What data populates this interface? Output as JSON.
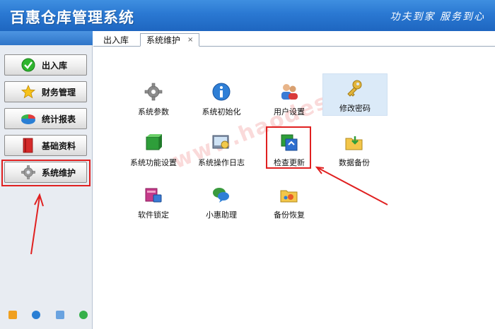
{
  "window": {
    "title": "百惠仓库管理系统",
    "slogan": "功夫到家 服务到心"
  },
  "sidebar": {
    "items": [
      {
        "label": "出入库",
        "icon": "check-circle-icon"
      },
      {
        "label": "财务管理",
        "icon": "star-icon"
      },
      {
        "label": "统计报表",
        "icon": "pie-chart-icon"
      },
      {
        "label": "基础资料",
        "icon": "book-icon"
      },
      {
        "label": "系统维护",
        "icon": "gear-icon"
      }
    ],
    "active_index": 4,
    "bottom_icons": [
      "note-icon",
      "info-icon",
      "search-window-icon",
      "exit-icon"
    ]
  },
  "tabs": [
    {
      "label": "出入库"
    },
    {
      "label": "系统维护",
      "close": "×"
    }
  ],
  "tiles": [
    {
      "label": "系统参数",
      "icon": "gears-icon"
    },
    {
      "label": "系统初始化",
      "icon": "info-icon"
    },
    {
      "label": "用户设置",
      "icon": "users-icon"
    },
    {
      "label": "修改密码",
      "icon": "key-icon"
    },
    {
      "label": "系统功能设置",
      "icon": "green-box-icon"
    },
    {
      "label": "系统操作日志",
      "icon": "log-icon"
    },
    {
      "label": "检查更新",
      "icon": "update-icon"
    },
    {
      "label": "数据备份",
      "icon": "folder-backup-icon"
    },
    {
      "label": "软件锁定",
      "icon": "lock-icon"
    },
    {
      "label": "小惠助理",
      "icon": "chat-icon"
    },
    {
      "label": "备份恢复",
      "icon": "folder-restore-icon"
    }
  ],
  "watermark": "www.haodes.com",
  "colors": {
    "titlebar": "#2a78d2",
    "highlight": "#e02020",
    "selected_tile": "#dbeaf8"
  }
}
